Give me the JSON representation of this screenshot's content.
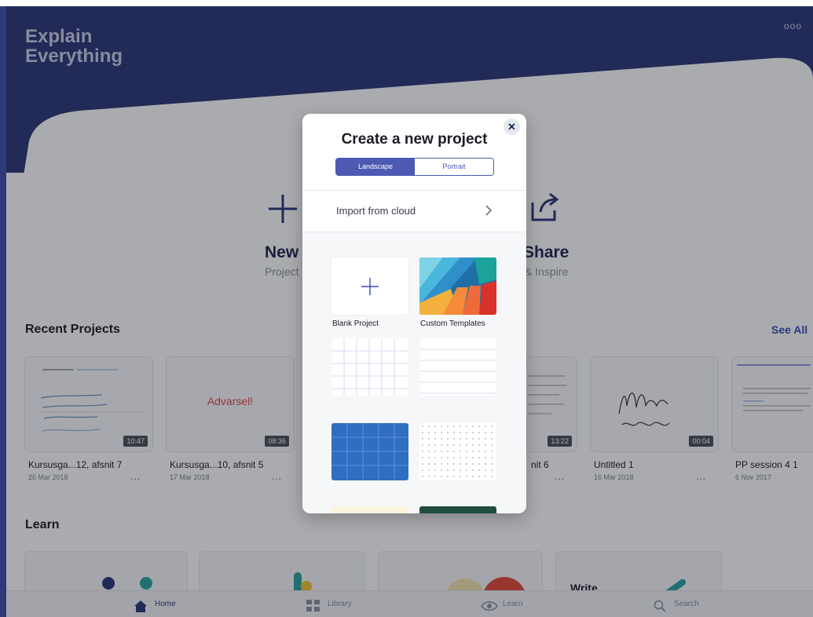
{
  "app": {
    "logo_line1": "Explain",
    "logo_line2": "Everything",
    "more_label": "ooo"
  },
  "hero": {
    "new": {
      "title": "New",
      "subtitle": "Project"
    },
    "share": {
      "title": "Share",
      "subtitle": "& Inspire"
    }
  },
  "recent": {
    "title": "Recent Projects",
    "see_all": "See All",
    "projects": [
      {
        "name": "Kursusga...12, afsnit 7",
        "date": "26 Mar 2018",
        "duration": "10:47",
        "more": "..."
      },
      {
        "name": "Kursusga...10, afsnit 5",
        "date": "17 Mar 2018",
        "duration": "08:36",
        "more": "...",
        "thumb_text": "Advarsel!"
      },
      {
        "name": "nit 6",
        "date": "",
        "duration": "13:22",
        "more": "..."
      },
      {
        "name": "Untitled 1",
        "date": "16 Mar 2018",
        "duration": "00:04",
        "more": "..."
      },
      {
        "name": "PP session 4 1",
        "date": "6 Nov 2017",
        "duration": "",
        "more": ""
      }
    ]
  },
  "learn": {
    "title": "Learn",
    "card_text": "Write."
  },
  "bottom_nav": [
    {
      "label": "Home",
      "icon": "home-icon",
      "active": true
    },
    {
      "label": "Library",
      "icon": "grid-icon",
      "active": false
    },
    {
      "label": "Learn",
      "icon": "eye-icon",
      "active": false
    },
    {
      "label": "Search",
      "icon": "search-icon",
      "active": false
    }
  ],
  "modal": {
    "title": "Create a new project",
    "close": "✕",
    "orientation": {
      "landscape": "Landscape",
      "portrait": "Portrait",
      "selected": "Landscape"
    },
    "import": "Import from cloud",
    "templates": [
      {
        "label": "Blank Project",
        "kind": "blank"
      },
      {
        "label": "Custom Templates",
        "kind": "custom"
      },
      {
        "label": "",
        "kind": "grid"
      },
      {
        "label": "",
        "kind": "lines"
      },
      {
        "label": "",
        "kind": "blue-grid"
      },
      {
        "label": "",
        "kind": "dots"
      }
    ]
  },
  "colors": {
    "brand_navy": "#2b3679",
    "accent_blue": "#4c5ab3",
    "link_blue": "#3a4bb8"
  }
}
